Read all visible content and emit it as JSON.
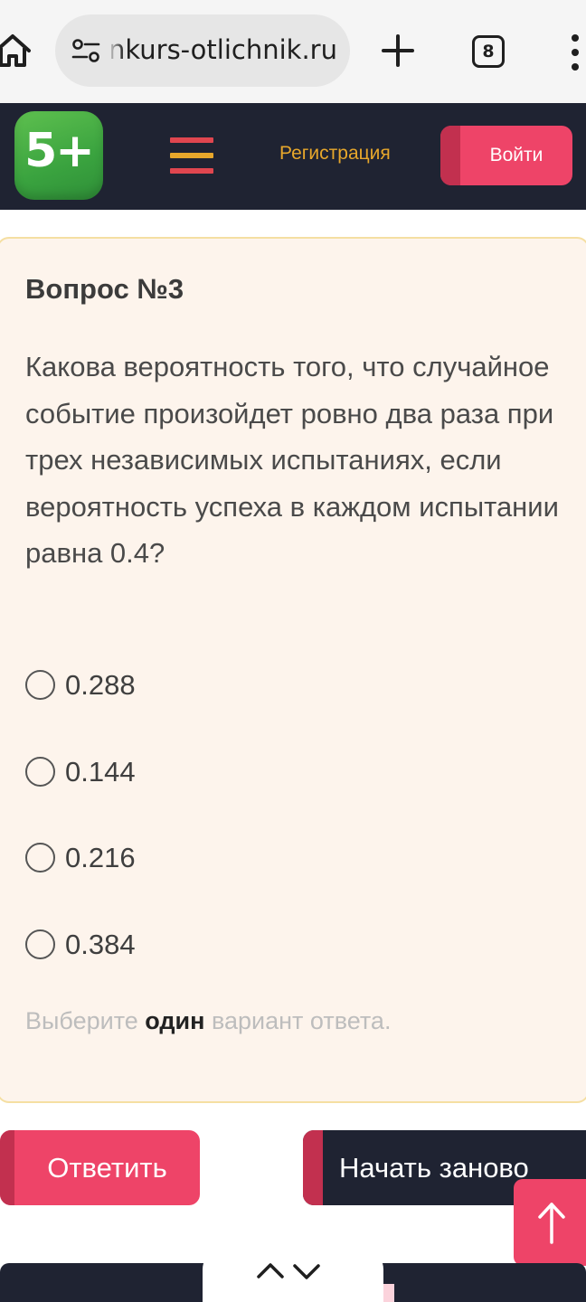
{
  "browser": {
    "url": "konkurs-otlichnik.ru",
    "tab_count": "8"
  },
  "header": {
    "logo_text": "5+",
    "register_label": "Регистрация",
    "login_label": "Войти",
    "accent_color": "#ee4468",
    "dark_color": "#1f2332",
    "link_color": "#e7a72b"
  },
  "question": {
    "title": "Вопрос №3",
    "text": "Какова вероятность того, что случайное событие произойдет ровно два раза при трех независимых испытаниях, если вероятность успеха в каждом испытании равна 0.4?",
    "options": [
      {
        "label": "0.288",
        "selected": false
      },
      {
        "label": "0.144",
        "selected": false
      },
      {
        "label": "0.216",
        "selected": false
      },
      {
        "label": "0.384",
        "selected": false
      }
    ],
    "hint_before": "Выберите ",
    "hint_bold": "один",
    "hint_after": " вариант ответа."
  },
  "actions": {
    "answer_label": "Ответить",
    "restart_label": "Начать заново"
  },
  "icons": {
    "home": "home-icon",
    "site_settings": "tune-icon",
    "new_tab": "plus-icon",
    "tabs": "tab-switcher-icon",
    "menu": "more-vert-icon",
    "hamburger": "hamburger-icon",
    "scroll_top": "arrow-up-icon",
    "find_prev": "chevron-up-icon",
    "find_next": "chevron-down-icon"
  }
}
